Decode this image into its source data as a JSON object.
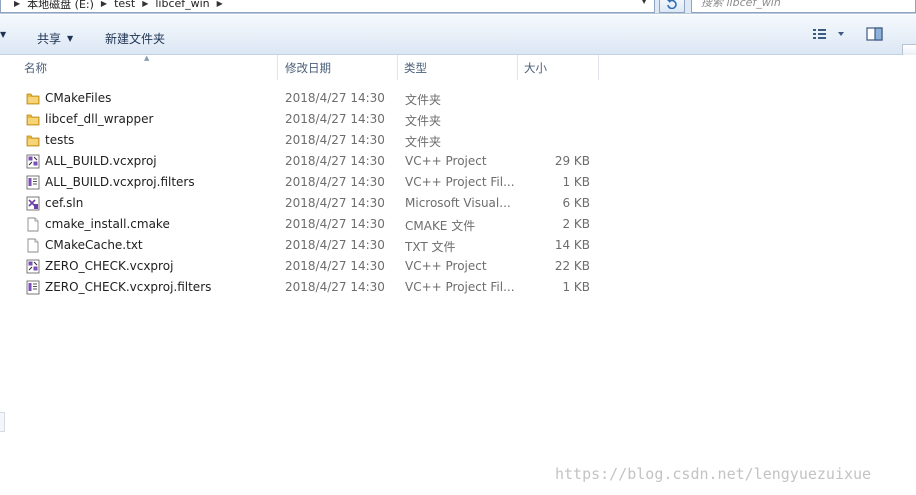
{
  "address": {
    "crumbs": [
      "本地磁盘 (E:)",
      "test",
      "libcef_win"
    ],
    "search_placeholder": "搜索 libcef_win"
  },
  "toolbar": {
    "share_label": "共享",
    "new_folder_label": "新建文件夹"
  },
  "columns": {
    "name": "名称",
    "date": "修改日期",
    "type": "类型",
    "size": "大小"
  },
  "files": [
    {
      "name": "CMakeFiles",
      "date": "2018/4/27 14:30",
      "type": "文件夹",
      "size": "",
      "icon": "folder-icon"
    },
    {
      "name": "libcef_dll_wrapper",
      "date": "2018/4/27 14:30",
      "type": "文件夹",
      "size": "",
      "icon": "folder-icon"
    },
    {
      "name": "tests",
      "date": "2018/4/27 14:30",
      "type": "文件夹",
      "size": "",
      "icon": "folder-icon"
    },
    {
      "name": "ALL_BUILD.vcxproj",
      "date": "2018/4/27 14:30",
      "type": "VC++ Project",
      "size": "29 KB",
      "icon": "vcxproj-icon"
    },
    {
      "name": "ALL_BUILD.vcxproj.filters",
      "date": "2018/4/27 14:30",
      "type": "VC++ Project Fil...",
      "size": "1 KB",
      "icon": "filters-icon"
    },
    {
      "name": "cef.sln",
      "date": "2018/4/27 14:30",
      "type": "Microsoft Visual...",
      "size": "6 KB",
      "icon": "sln-icon"
    },
    {
      "name": "cmake_install.cmake",
      "date": "2018/4/27 14:30",
      "type": "CMAKE 文件",
      "size": "2 KB",
      "icon": "document-icon"
    },
    {
      "name": "CMakeCache.txt",
      "date": "2018/4/27 14:30",
      "type": "TXT 文件",
      "size": "14 KB",
      "icon": "document-icon"
    },
    {
      "name": "ZERO_CHECK.vcxproj",
      "date": "2018/4/27 14:30",
      "type": "VC++ Project",
      "size": "22 KB",
      "icon": "vcxproj-icon"
    },
    {
      "name": "ZERO_CHECK.vcxproj.filters",
      "date": "2018/4/27 14:30",
      "type": "VC++ Project Fil...",
      "size": "1 KB",
      "icon": "filters-icon"
    }
  ],
  "watermark": "https://blog.csdn.net/lengyuezuixue",
  "colors": {
    "folder": "#e8b83a",
    "toolbar_top": "#f5f9fd",
    "toolbar_bottom": "#dce7f4",
    "header_text": "#4c607a"
  }
}
